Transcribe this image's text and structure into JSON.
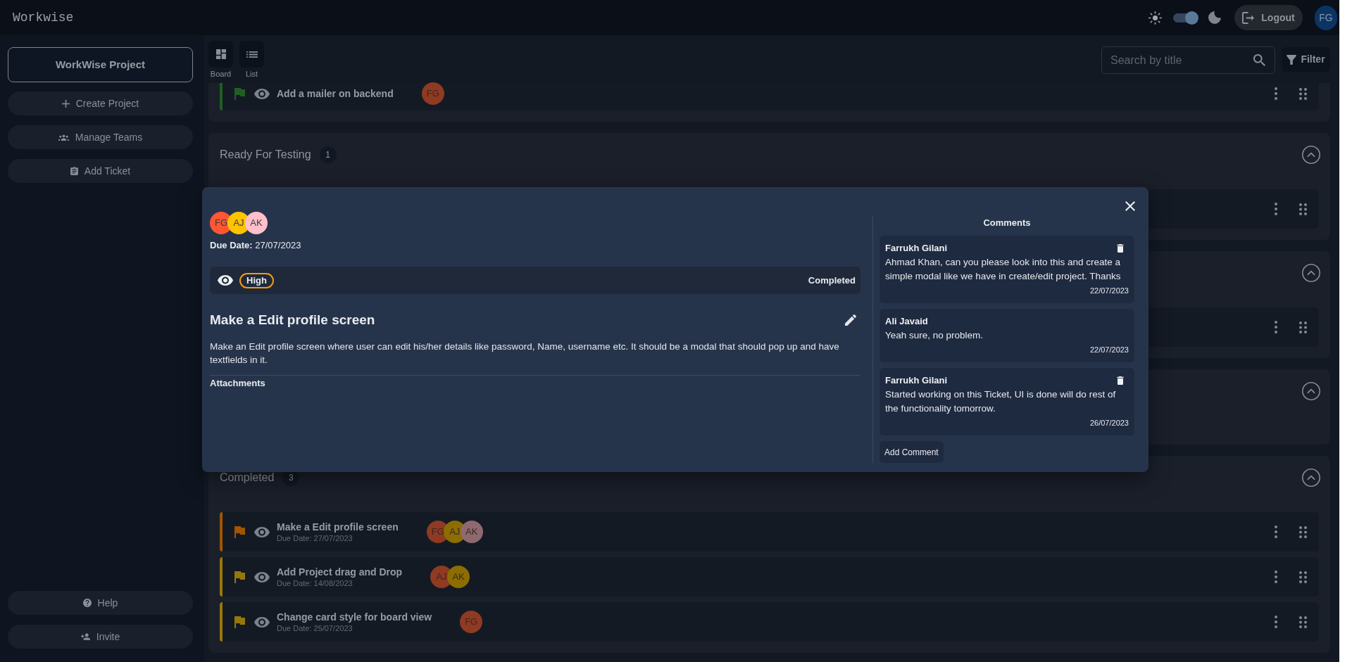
{
  "header": {
    "app_name": "Workwise",
    "theme_switch": {
      "on": true
    },
    "logout": "Logout",
    "user_avatar": "FG"
  },
  "sidebar": {
    "project": "WorkWise Project",
    "actions": [
      {
        "kind": "add",
        "label": "Create Project"
      },
      {
        "kind": "teams",
        "label": "Manage Teams"
      },
      {
        "kind": "ticket",
        "label": "Add Ticket"
      }
    ],
    "footer_actions": [
      {
        "kind": "help",
        "label": "Help"
      },
      {
        "kind": "invite",
        "label": "Invite"
      }
    ]
  },
  "toolbar": {
    "views": [
      {
        "kind": "board",
        "label": "Board"
      },
      {
        "kind": "list",
        "label": "List"
      }
    ],
    "search": {
      "placeholder": "Search by title"
    },
    "filter": "Filter"
  },
  "sections": [
    {
      "rows": [
        {
          "kind": "ticket",
          "title": "Add a mailer on backend",
          "color": "#1f5f24",
          "avatars": [
            {
              "initials": "FG",
              "color": "#8f3a22"
            }
          ]
        }
      ]
    },
    {
      "title": "Ready For Testing",
      "count": "1",
      "expanded": true,
      "rows": [
        {
          "kind": "covered"
        }
      ]
    },
    {
      "expanded": true,
      "rows": [
        {
          "kind": "covered"
        }
      ]
    },
    {
      "expanded": true
    },
    {
      "title": "Completed",
      "count": "3",
      "expanded": true,
      "rows": [
        {
          "kind": "ticket",
          "title": "Make a Edit profile screen",
          "due_date": "Due Date: 27/07/2023",
          "color": "#a05500",
          "avatars": [
            {
              "initials": "FG",
              "color": "#8f3a22"
            },
            {
              "initials": "AJ",
              "color": "#8b6d00"
            },
            {
              "initials": "AK",
              "color": "#8e6a70"
            }
          ]
        },
        {
          "kind": "ticket",
          "title": "Add Project drag and Drop",
          "due_date": "Due Date: 14/08/2023",
          "color": "#96780a",
          "avatars": [
            {
              "initials": "AJ",
              "color": "#8f3a22"
            },
            {
              "initials": "AK",
              "color": "#8b6d00"
            }
          ]
        },
        {
          "kind": "ticket",
          "title": "Change card style for board view",
          "due_date": "Due Date: 25/07/2023",
          "color": "#96780a",
          "avatars": [
            {
              "initials": "FG",
              "color": "#8f3a22"
            }
          ]
        }
      ]
    }
  ],
  "modal": {
    "assignees": [
      {
        "initials": "FG",
        "color": "#ff5733"
      },
      {
        "initials": "AJ",
        "color": "#ffc300"
      },
      {
        "initials": "AK",
        "color": "#ffc0cb"
      }
    ],
    "due_date": "**Due Date:** 27/07/2023",
    "priority": "High",
    "status": "Completed",
    "title": "Make a Edit profile screen",
    "description": "Make an Edit profile screen where user can edit his/her details like password, Name, username etc. It should be a modal that should pop up and have textfields in it.",
    "attachments_label": "Attachments",
    "comments_title": "Comments",
    "comments": [
      {
        "author": "Farrukh Gilani",
        "text": "Ahmad Khan, can you please look into this and create a simple modal like we have in create/edit project. Thanks",
        "date": "22/07/2023",
        "can_delete": true
      },
      {
        "author": "Ali Javaid",
        "text": "Yeah sure, no problem.",
        "date": "22/07/2023",
        "can_delete": false
      },
      {
        "author": "Farrukh Gilani",
        "text": "Started working on this Ticket, UI is done will do rest of the functionality tomorrow.",
        "date": "26/07/2023",
        "can_delete": true
      }
    ],
    "add_comment": "Add Comment"
  }
}
